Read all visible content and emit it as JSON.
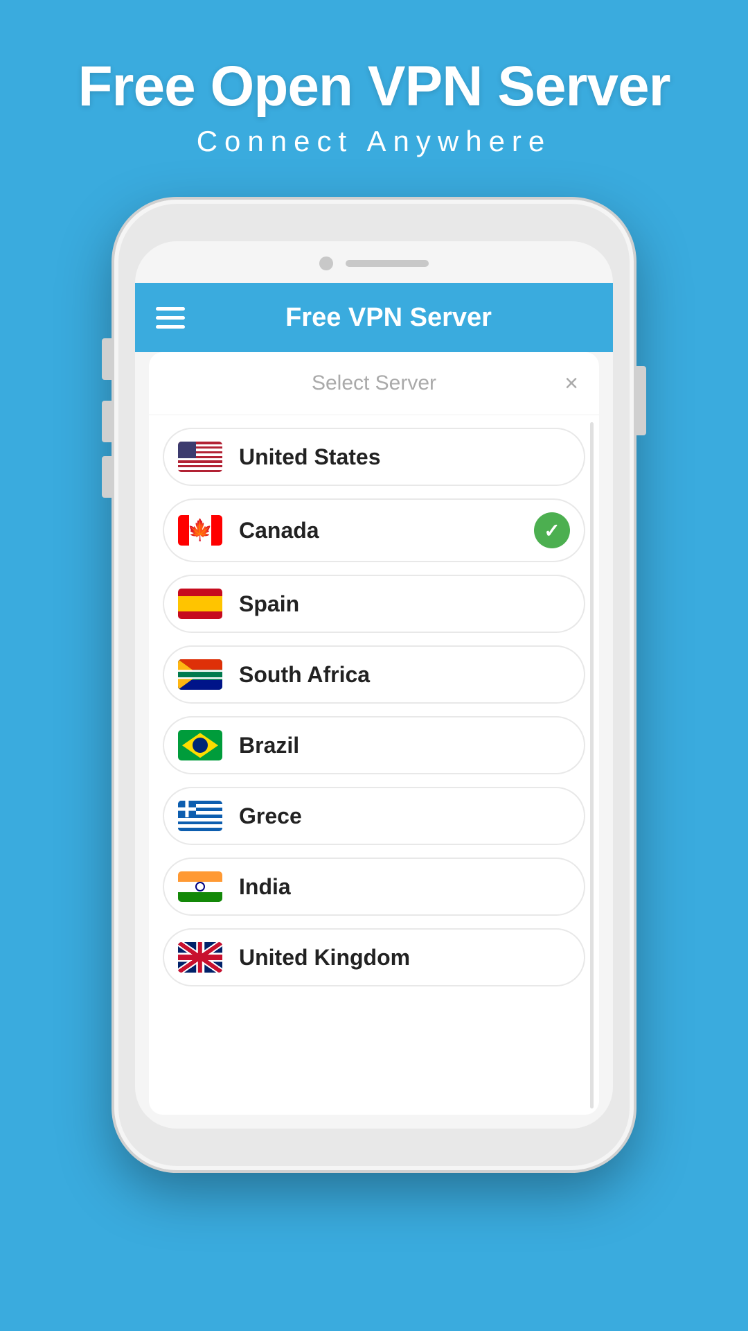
{
  "header": {
    "title": "Free Open VPN Server",
    "subtitle": "Connect Anywhere"
  },
  "app": {
    "navbar_title": "Free VPN Server",
    "menu_icon": "≡"
  },
  "panel": {
    "title": "Select Server",
    "close_label": "×"
  },
  "servers": [
    {
      "id": "us",
      "name": "United States",
      "flag": "us",
      "selected": false
    },
    {
      "id": "ca",
      "name": "Canada",
      "flag": "ca",
      "selected": true
    },
    {
      "id": "es",
      "name": "Spain",
      "flag": "es",
      "selected": false
    },
    {
      "id": "za",
      "name": "South Africa",
      "flag": "za",
      "selected": false
    },
    {
      "id": "br",
      "name": "Brazil",
      "flag": "br",
      "selected": false
    },
    {
      "id": "gr",
      "name": "Grece",
      "flag": "gr",
      "selected": false
    },
    {
      "id": "in",
      "name": "India",
      "flag": "in",
      "selected": false
    },
    {
      "id": "gb",
      "name": "United Kingdom",
      "flag": "gb",
      "selected": false
    }
  ],
  "colors": {
    "bg": "#3aabde",
    "navbar": "#3aabde",
    "selected_check": "#4CAF50"
  }
}
